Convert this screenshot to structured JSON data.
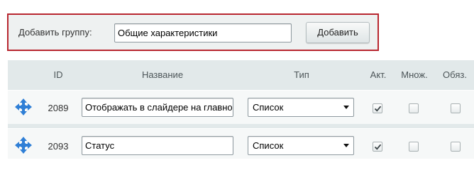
{
  "add_group": {
    "label": "Добавить группу:",
    "input_value": "Общие характеристики",
    "button_label": "Добавить"
  },
  "table": {
    "headers": {
      "id": "ID",
      "name": "Название",
      "type": "Тип",
      "active": "Акт.",
      "multiple": "Множ.",
      "required": "Обяз."
    },
    "rows": [
      {
        "id": "2089",
        "name": "Отображать в слайдере на главной",
        "type": "Список",
        "active": true,
        "multiple": false,
        "required": false
      },
      {
        "id": "2093",
        "name": "Статус",
        "type": "Список",
        "active": true,
        "multiple": false,
        "required": false
      }
    ]
  },
  "colors": {
    "highlight_border": "#b8262f",
    "move_icon": "#2f7fd6"
  },
  "icons": {
    "move": "four-way-arrow",
    "check": "checkmark"
  }
}
